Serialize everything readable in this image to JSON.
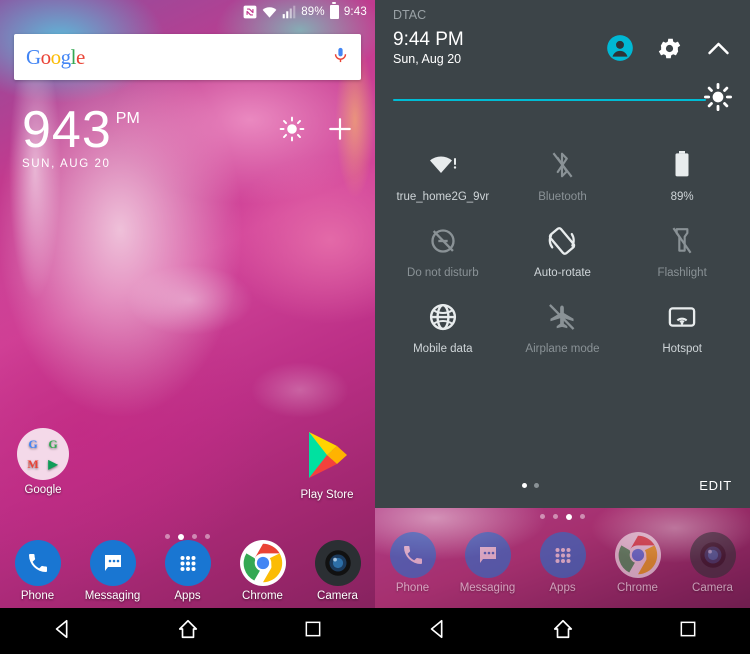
{
  "home": {
    "statusbar": {
      "nfc_icon": "nfc-icon",
      "wifi_icon": "wifi-icon",
      "signal_icon": "cellular-signal-icon",
      "battery_percent": "89%",
      "battery_icon": "battery-icon",
      "time": "9:43"
    },
    "search": {
      "logo_letters": [
        "G",
        "o",
        "o",
        "g",
        "l",
        "e"
      ],
      "mic_icon": "microphone-icon"
    },
    "clock": {
      "hour": "9",
      "minute": "43",
      "ampm": "PM",
      "date": "SUN, AUG 20",
      "brightness_icon": "brightness-icon",
      "add_icon": "plus-icon"
    },
    "icons": [
      {
        "name": "google-folder",
        "label": "Google",
        "type": "folder",
        "mini": [
          {
            "g": "G",
            "c": "#4285F4"
          },
          {
            "g": "G",
            "c": "#34A853"
          },
          {
            "g": "M",
            "c": "#EA4335"
          },
          {
            "g": "▶",
            "c": "#0F9D58"
          }
        ]
      },
      {
        "name": "play-store",
        "label": "Play Store",
        "type": "playstore"
      }
    ],
    "page_dots": {
      "count": 4,
      "active_index": 1
    },
    "dock": [
      {
        "name": "phone",
        "label": "Phone",
        "icon": "phone-icon"
      },
      {
        "name": "messaging",
        "label": "Messaging",
        "icon": "messaging-icon"
      },
      {
        "name": "apps",
        "label": "Apps",
        "icon": "apps-grid-icon"
      },
      {
        "name": "chrome",
        "label": "Chrome",
        "icon": "chrome-icon"
      },
      {
        "name": "camera",
        "label": "Camera",
        "icon": "camera-icon"
      }
    ],
    "navbar": [
      {
        "name": "back",
        "icon": "back-triangle-icon"
      },
      {
        "name": "home",
        "icon": "home-icon"
      },
      {
        "name": "recents",
        "icon": "recents-square-icon"
      }
    ]
  },
  "quicksettings": {
    "carrier": "DTAC",
    "time": "9:44 PM",
    "date": "Sun, Aug 20",
    "header_icons": [
      {
        "name": "user-account-icon",
        "icon": "user-icon"
      },
      {
        "name": "settings-icon",
        "icon": "gear-icon"
      },
      {
        "name": "collapse-icon",
        "icon": "chevron-up-icon"
      }
    ],
    "brightness": {
      "icon": "brightness-slider-icon",
      "value": 100,
      "accent": "#00bcd4"
    },
    "tiles": [
      {
        "name": "wifi",
        "label": "true_home2G_9vr",
        "icon": "wifi-icon",
        "state": "on"
      },
      {
        "name": "bluetooth",
        "label": "Bluetooth",
        "icon": "bluetooth-off-icon",
        "state": "off"
      },
      {
        "name": "battery",
        "label": "89%",
        "icon": "battery-icon",
        "state": "on"
      },
      {
        "name": "do-not-disturb",
        "label": "Do not disturb",
        "icon": "dnd-off-icon",
        "state": "off"
      },
      {
        "name": "auto-rotate",
        "label": "Auto-rotate",
        "icon": "auto-rotate-icon",
        "state": "on"
      },
      {
        "name": "flashlight",
        "label": "Flashlight",
        "icon": "flashlight-off-icon",
        "state": "off"
      },
      {
        "name": "mobile-data",
        "label": "Mobile data",
        "icon": "globe-icon",
        "state": "on"
      },
      {
        "name": "airplane-mode",
        "label": "Airplane mode",
        "icon": "airplane-off-icon",
        "state": "off"
      },
      {
        "name": "hotspot",
        "label": "Hotspot",
        "icon": "hotspot-icon",
        "state": "on"
      }
    ],
    "panel_dots": {
      "count": 2,
      "active_index": 0
    },
    "edit_label": "EDIT",
    "home_page_dots": {
      "count": 4,
      "active_index": 2
    },
    "dock": [
      {
        "name": "phone",
        "label": "Phone",
        "icon": "phone-icon"
      },
      {
        "name": "messaging",
        "label": "Messaging",
        "icon": "messaging-icon"
      },
      {
        "name": "apps",
        "label": "Apps",
        "icon": "apps-grid-icon"
      },
      {
        "name": "chrome",
        "label": "Chrome",
        "icon": "chrome-icon"
      },
      {
        "name": "camera",
        "label": "Camera",
        "icon": "camera-icon"
      }
    ],
    "navbar": [
      {
        "name": "back",
        "icon": "back-triangle-icon"
      },
      {
        "name": "home",
        "icon": "home-icon"
      },
      {
        "name": "recents",
        "icon": "recents-square-icon"
      }
    ]
  }
}
